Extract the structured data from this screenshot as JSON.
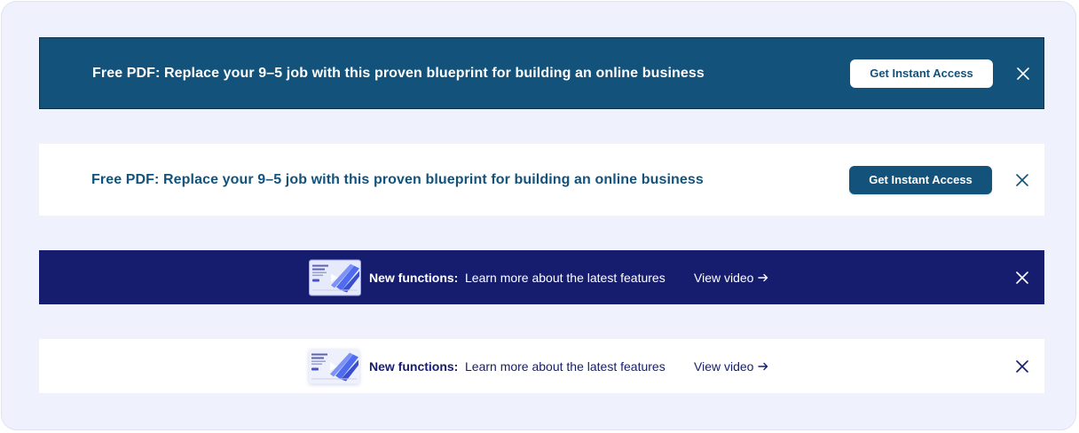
{
  "banners": [
    {
      "variant": "dark-teal",
      "message": "Free PDF: Replace your 9–5 job with this proven blueprint for building an online business",
      "cta_label": "Get Instant Access",
      "close_icon": "close-icon",
      "colors": {
        "background": "#13527a",
        "text": "#ffffff",
        "button_bg": "#ffffff",
        "button_text": "#13527a"
      }
    },
    {
      "variant": "light",
      "message": "Free PDF: Replace your 9–5 job with this proven blueprint for building an online business",
      "cta_label": "Get Instant Access",
      "close_icon": "close-icon",
      "colors": {
        "background": "#ffffff",
        "text": "#13527a",
        "button_bg": "#13527a",
        "button_text": "#ffffff"
      }
    },
    {
      "variant": "dark-navy",
      "thumbnail_icon": "video-thumbnail",
      "label_bold": "New functions:",
      "label_text": "Learn more about the latest features",
      "link_label": "View video",
      "link_icon": "arrow-right-icon",
      "close_icon": "close-icon",
      "colors": {
        "background": "#161d6e",
        "text": "#ffffff"
      }
    },
    {
      "variant": "light",
      "thumbnail_icon": "video-thumbnail",
      "label_bold": "New functions:",
      "label_text": "Learn more about the latest features",
      "link_label": "View video",
      "link_icon": "arrow-right-icon",
      "close_icon": "close-icon",
      "colors": {
        "background": "#ffffff",
        "text": "#161d6e"
      }
    }
  ],
  "colors": {
    "page_background": "#eff2fd"
  }
}
